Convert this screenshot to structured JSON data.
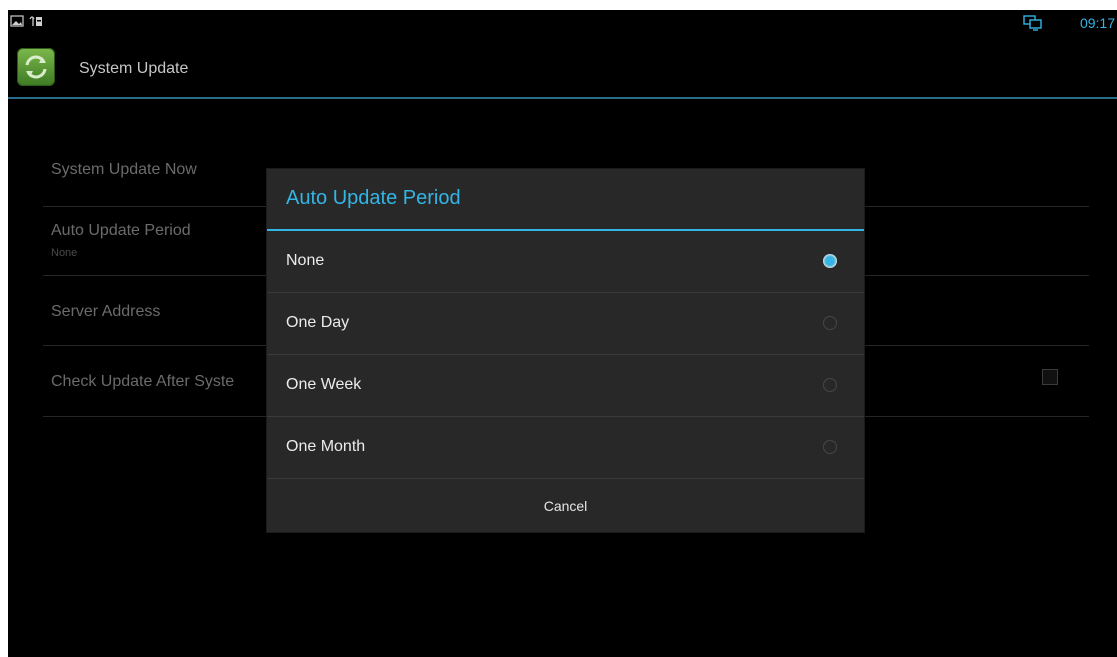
{
  "status_bar": {
    "time": "09:17",
    "icons": [
      "gallery-icon",
      "usb-debug-icon",
      "network-display-icon"
    ]
  },
  "action_bar": {
    "icon": "sync-icon",
    "title": "System Update"
  },
  "preferences": [
    {
      "title": "System Update Now",
      "summary": ""
    },
    {
      "title": "Auto Update Period",
      "summary": "None"
    },
    {
      "title": "Server Address",
      "summary": ""
    },
    {
      "title": "Check Update After Syste",
      "summary": "",
      "checked": false
    }
  ],
  "dialog": {
    "title": "Auto Update Period",
    "options": [
      {
        "label": "None",
        "selected": true
      },
      {
        "label": "One Day",
        "selected": false
      },
      {
        "label": "One Week",
        "selected": false
      },
      {
        "label": "One Month",
        "selected": false
      }
    ],
    "cancel_label": "Cancel"
  },
  "colors": {
    "accent": "#33b5e5",
    "background": "#000000",
    "dialog_bg": "#282828"
  }
}
